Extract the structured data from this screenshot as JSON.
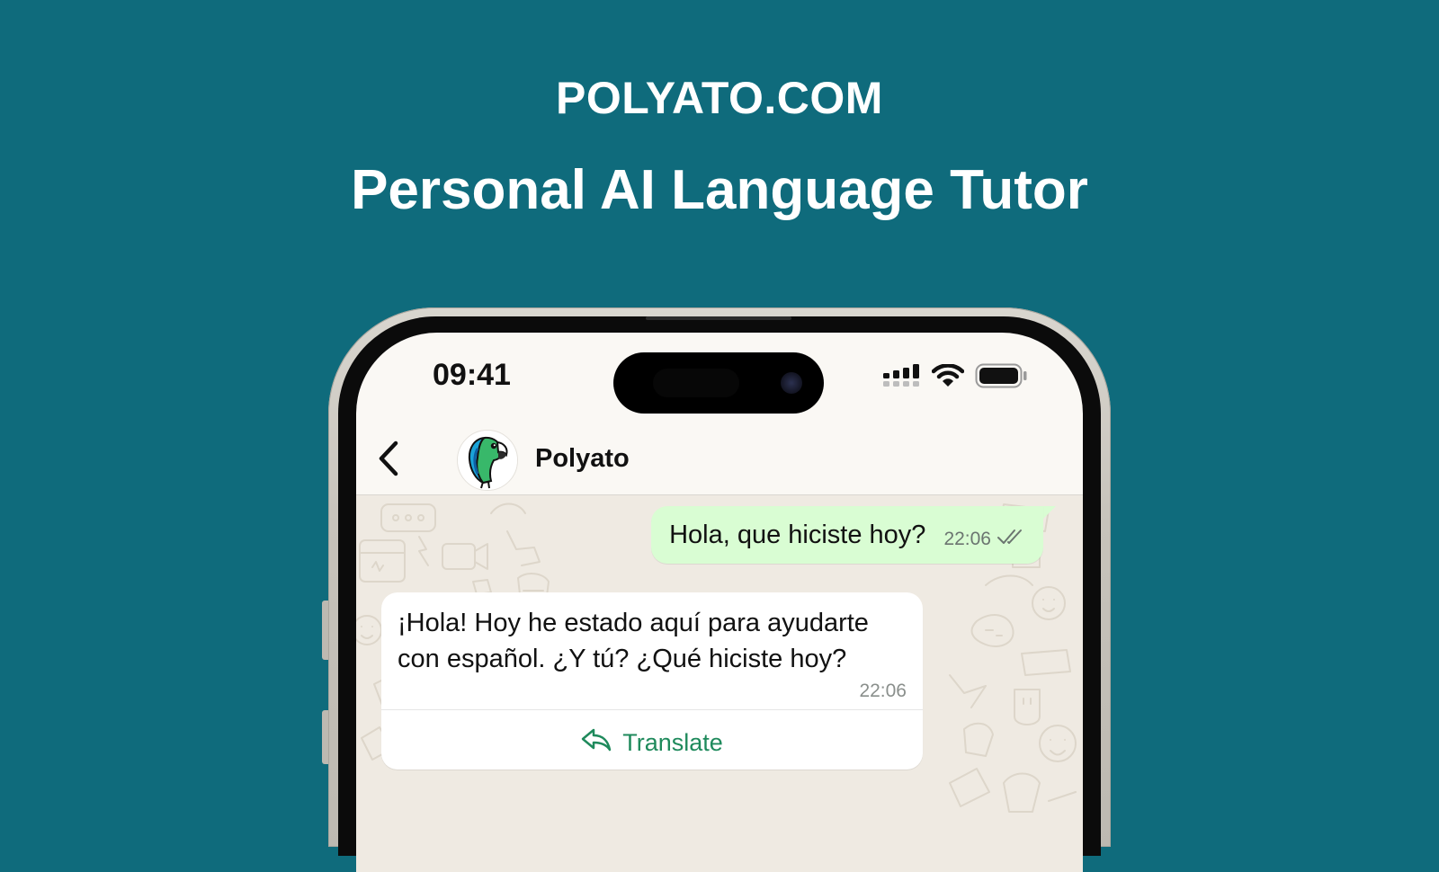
{
  "banner": {
    "site": "POLYATO.COM",
    "tagline": "Personal AI Language Tutor"
  },
  "status_bar": {
    "time": "09:41",
    "icons": [
      "cellular-signal-icon",
      "wifi-icon",
      "battery-icon"
    ]
  },
  "chat_header": {
    "back_icon": "chevron-left-icon",
    "avatar": "parrot-avatar",
    "contact_name": "Polyato"
  },
  "messages": [
    {
      "direction": "outgoing",
      "text": "Hola, que hiciste hoy?",
      "time": "22:06",
      "status_icon": "double-check-icon"
    },
    {
      "direction": "incoming",
      "text": "¡Hola! Hoy he estado aquí para ayudarte con español. ¿Y tú? ¿Qué hiciste hoy?",
      "time": "22:06",
      "action_label": "Translate",
      "action_icon": "translate-icon"
    }
  ],
  "colors": {
    "background": "#0f6b7c",
    "outgoing_bubble": "#d9fdd3",
    "incoming_bubble": "#ffffff",
    "chat_wallpaper": "#efeae2",
    "action_green": "#1f8a5c"
  }
}
